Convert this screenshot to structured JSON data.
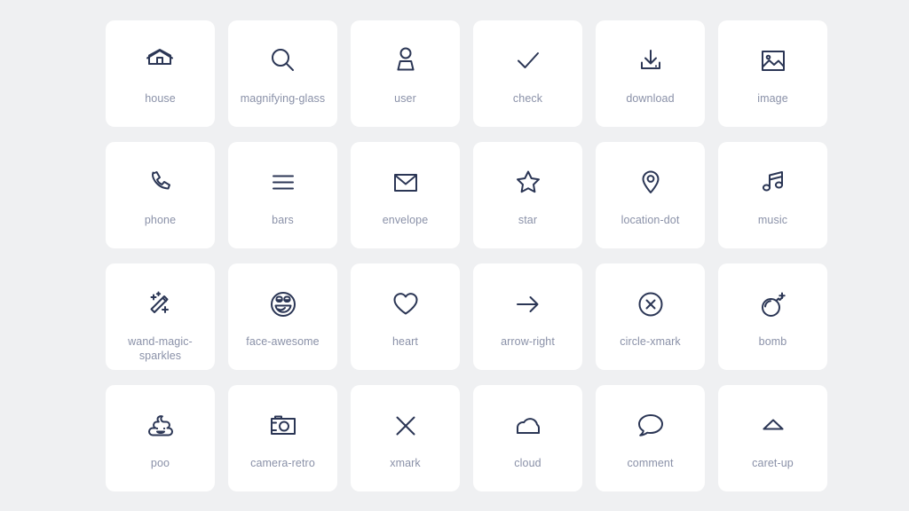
{
  "page": {
    "background_color": "#eff0f2",
    "card_color": "#ffffff",
    "icon_color": "#2b3655",
    "label_color": "#8a91a8",
    "columns": 6,
    "rows": 4
  },
  "icons": [
    {
      "name": "house",
      "label": "house"
    },
    {
      "name": "magnifying-glass",
      "label": "magnifying-glass"
    },
    {
      "name": "user",
      "label": "user"
    },
    {
      "name": "check",
      "label": "check"
    },
    {
      "name": "download",
      "label": "download"
    },
    {
      "name": "image",
      "label": "image"
    },
    {
      "name": "phone",
      "label": "phone"
    },
    {
      "name": "bars",
      "label": "bars"
    },
    {
      "name": "envelope",
      "label": "envelope"
    },
    {
      "name": "star",
      "label": "star"
    },
    {
      "name": "location-dot",
      "label": "location-dot"
    },
    {
      "name": "music",
      "label": "music"
    },
    {
      "name": "wand-magic-sparkles",
      "label": "wand-magic-sparkles"
    },
    {
      "name": "face-awesome",
      "label": "face-awesome"
    },
    {
      "name": "heart",
      "label": "heart"
    },
    {
      "name": "arrow-right",
      "label": "arrow-right"
    },
    {
      "name": "circle-xmark",
      "label": "circle-xmark"
    },
    {
      "name": "bomb",
      "label": "bomb"
    },
    {
      "name": "poo",
      "label": "poo"
    },
    {
      "name": "camera-retro",
      "label": "camera-retro"
    },
    {
      "name": "xmark",
      "label": "xmark"
    },
    {
      "name": "cloud",
      "label": "cloud"
    },
    {
      "name": "comment",
      "label": "comment"
    },
    {
      "name": "caret-up",
      "label": "caret-up"
    }
  ]
}
